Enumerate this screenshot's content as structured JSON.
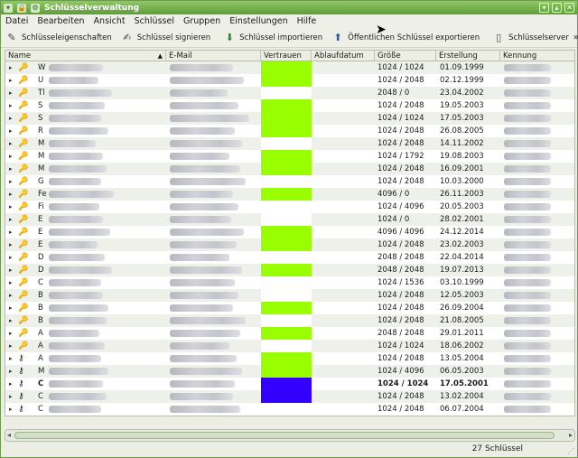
{
  "window": {
    "title": "Schlüsselverwaltung"
  },
  "menu": [
    {
      "label": "Datei",
      "accel": "D"
    },
    {
      "label": "Bearbeiten",
      "accel": "B"
    },
    {
      "label": "Ansicht",
      "accel": "A"
    },
    {
      "label": "Schlüssel",
      "accel": "S"
    },
    {
      "label": "Gruppen",
      "accel": "G"
    },
    {
      "label": "Einstellungen",
      "accel": "E"
    },
    {
      "label": "Hilfe",
      "accel": "H"
    }
  ],
  "toolbar": {
    "key_properties": "Schlüsseleigenschaften",
    "sign_key": "Schlüssel signieren",
    "import_key": "Schlüssel importieren",
    "export_public_key": "Öffentlichen Schlüssel exportieren",
    "keyserver": "Schlüsselserver",
    "more": "»"
  },
  "columns": {
    "name": "Name",
    "email": "E-Mail",
    "trust": "Vertrauen",
    "expiry": "Ablaufdatum",
    "size": "Größe",
    "created": "Erstellung",
    "id": "Kennung"
  },
  "colors": {
    "trust_full": "#99ff00",
    "trust_ultimate": "#3300ff",
    "trust_none": "#ffffff"
  },
  "rows": [
    {
      "initial": "W",
      "trust": "full",
      "size": "1024 / 1024",
      "created": "01.09.1999",
      "bold": false,
      "icon": "key"
    },
    {
      "initial": "U",
      "trust": "full",
      "size": "1024 / 2048",
      "created": "02.12.1999",
      "bold": false,
      "icon": "key"
    },
    {
      "initial": "Tl",
      "trust": "none",
      "size": "2048 / 0",
      "created": "23.04.2002",
      "bold": false,
      "icon": "key"
    },
    {
      "initial": "S",
      "trust": "full",
      "size": "1024 / 2048",
      "created": "19.05.2003",
      "bold": false,
      "icon": "key"
    },
    {
      "initial": "S",
      "trust": "full",
      "size": "1024 / 1024",
      "created": "17.05.2003",
      "bold": false,
      "icon": "key"
    },
    {
      "initial": "R",
      "trust": "full",
      "size": "1024 / 2048",
      "created": "26.08.2005",
      "bold": false,
      "icon": "key"
    },
    {
      "initial": "M",
      "trust": "none",
      "size": "1024 / 2048",
      "created": "14.11.2002",
      "bold": false,
      "icon": "key"
    },
    {
      "initial": "M",
      "trust": "full",
      "size": "1024 / 1792",
      "created": "19.08.2003",
      "bold": false,
      "icon": "key"
    },
    {
      "initial": "M",
      "trust": "full",
      "size": "1024 / 2048",
      "created": "16.09.2001",
      "bold": false,
      "icon": "key"
    },
    {
      "initial": "G",
      "trust": "none",
      "size": "1024 / 2048",
      "created": "10.03.2000",
      "bold": false,
      "icon": "key"
    },
    {
      "initial": "Fe",
      "trust": "full",
      "size": "4096 / 0",
      "created": "26.11.2003",
      "bold": false,
      "icon": "key"
    },
    {
      "initial": "Fi",
      "trust": "none",
      "size": "1024 / 4096",
      "created": "20.05.2003",
      "bold": false,
      "icon": "key"
    },
    {
      "initial": "E",
      "trust": "none",
      "size": "1024 / 0",
      "created": "28.02.2001",
      "bold": false,
      "icon": "key"
    },
    {
      "initial": "E",
      "trust": "full",
      "size": "4096 / 4096",
      "created": "24.12.2014",
      "bold": false,
      "icon": "key"
    },
    {
      "initial": "E",
      "trust": "full",
      "size": "1024 / 2048",
      "created": "23.02.2003",
      "bold": false,
      "icon": "key"
    },
    {
      "initial": "D",
      "trust": "none",
      "size": "2048 / 2048",
      "created": "22.04.2014",
      "bold": false,
      "icon": "key"
    },
    {
      "initial": "D",
      "trust": "full",
      "size": "2048 / 2048",
      "created": "19.07.2013",
      "bold": false,
      "icon": "key"
    },
    {
      "initial": "C",
      "trust": "none",
      "size": "1024 / 1536",
      "created": "03.10.1999",
      "bold": false,
      "icon": "key"
    },
    {
      "initial": "B",
      "trust": "none",
      "size": "1024 / 2048",
      "created": "12.05.2003",
      "bold": false,
      "icon": "key"
    },
    {
      "initial": "B",
      "trust": "full",
      "size": "1024 / 2048",
      "created": "26.09.2004",
      "bold": false,
      "icon": "key"
    },
    {
      "initial": "B",
      "trust": "none",
      "size": "1024 / 2048",
      "created": "21.08.2005",
      "bold": false,
      "icon": "key"
    },
    {
      "initial": "A",
      "trust": "full",
      "size": "2048 / 2048",
      "created": "29.01.2011",
      "bold": false,
      "icon": "key"
    },
    {
      "initial": "A",
      "trust": "none",
      "size": "1024 / 1024",
      "created": "18.06.2002",
      "bold": false,
      "icon": "key"
    },
    {
      "initial": "A",
      "trust": "full",
      "size": "1024 / 2048",
      "created": "13.05.2004",
      "bold": false,
      "icon": "keypair"
    },
    {
      "initial": "M",
      "trust": "full",
      "size": "1024 / 4096",
      "created": "06.05.2003",
      "bold": false,
      "icon": "keypair"
    },
    {
      "initial": "C",
      "trust": "ultimate",
      "size": "1024 / 1024",
      "created": "17.05.2001",
      "bold": true,
      "icon": "keypair"
    },
    {
      "initial": "C",
      "trust": "ultimate",
      "size": "1024 / 2048",
      "created": "13.02.2004",
      "bold": false,
      "icon": "keypair"
    },
    {
      "initial": "C",
      "trust": "none",
      "size": "1024 / 2048",
      "created": "06.07.2004",
      "bold": false,
      "icon": "keypair"
    }
  ],
  "status": {
    "count": "27 Schlüssel"
  }
}
